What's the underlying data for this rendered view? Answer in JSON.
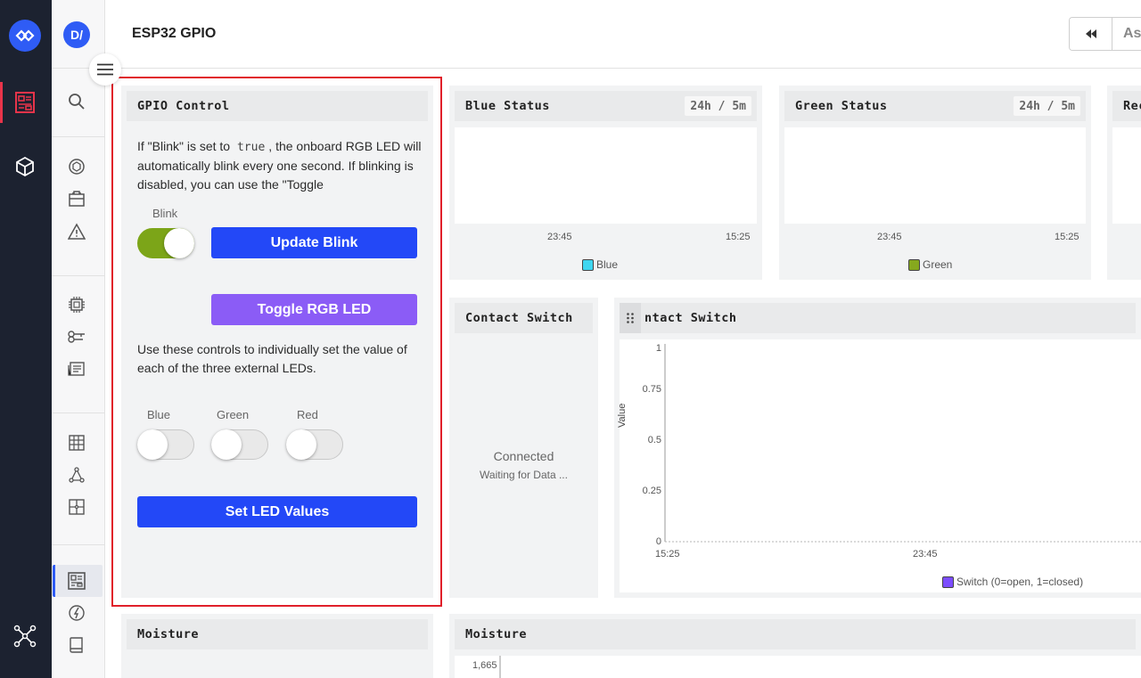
{
  "header": {
    "title": "ESP32 GPIO",
    "search_partial": "As"
  },
  "sidebar": {
    "avatar": "D/"
  },
  "gpio": {
    "title": "GPIO Control",
    "desc_pre": "If \"Blink\" is set to ",
    "desc_code": "true",
    "desc_post": ", the onboard RGB LED will automatically blink every one second. If blinking is disabled, you can use the \"Toggle",
    "blink_label": "Blink",
    "blink_on": true,
    "update_blink": "Update Blink",
    "toggle_rgb": "Toggle RGB LED",
    "desc2": "Use these controls to individually set the value of each of the three external LEDs.",
    "switches": [
      {
        "label": "Blue",
        "on": false
      },
      {
        "label": "Green",
        "on": false
      },
      {
        "label": "Red",
        "on": false
      }
    ],
    "set_led": "Set LED Values"
  },
  "blue_status": {
    "title": "Blue Status",
    "range": "24h / 5m",
    "x_ticks": [
      "23:45",
      "15:25"
    ],
    "legend": "Blue",
    "color": "#3fd6f0"
  },
  "green_status": {
    "title": "Green Status",
    "range": "24h / 5m",
    "x_ticks": [
      "23:45",
      "15:25"
    ],
    "legend": "Green",
    "color": "#86a81e"
  },
  "red_status": {
    "title": "Rec"
  },
  "contact_indicator": {
    "title": "Contact Switch",
    "status": "Connected",
    "substatus": "Waiting for Data ..."
  },
  "contact_chart": {
    "title": "ntact Switch",
    "ylabel": "Value",
    "y_ticks": [
      "1",
      "0.75",
      "0.5",
      "0.25",
      "0"
    ],
    "x_ticks": [
      "15:25",
      "23:45"
    ],
    "legend": "Switch (0=open, 1=closed)",
    "color": "#7c4dff"
  },
  "moisture1": {
    "title": "Moisture"
  },
  "moisture2": {
    "title": "Moisture",
    "y_top": "1,665"
  },
  "chart_data": [
    {
      "type": "line",
      "title": "Blue Status",
      "x_ticks": [
        "23:45",
        "15:25"
      ],
      "series": [
        {
          "name": "Blue",
          "values": []
        }
      ]
    },
    {
      "type": "line",
      "title": "Green Status",
      "x_ticks": [
        "23:45",
        "15:25"
      ],
      "series": [
        {
          "name": "Green",
          "values": []
        }
      ]
    },
    {
      "type": "line",
      "title": "Contact Switch",
      "ylabel": "Value",
      "ylim": [
        0,
        1
      ],
      "y_ticks": [
        1,
        0.75,
        0.5,
        0.25,
        0
      ],
      "x_ticks": [
        "15:25",
        "23:45"
      ],
      "series": [
        {
          "name": "Switch (0=open, 1=closed)",
          "values": []
        }
      ]
    }
  ]
}
